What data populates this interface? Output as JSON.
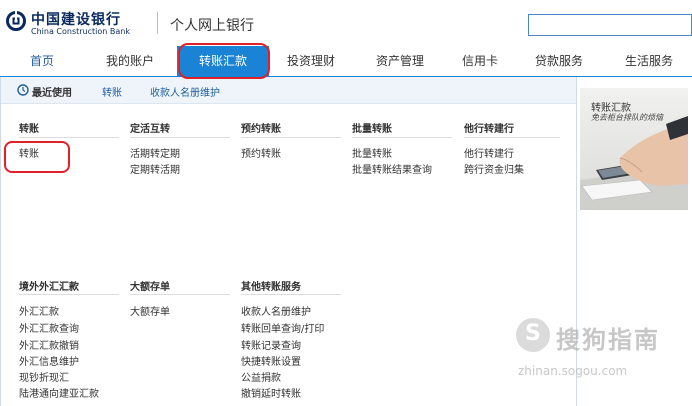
{
  "header": {
    "bank_name_cn": "中国建设银行",
    "bank_name_en": "China Construction Bank",
    "site_title": "个人网上银行"
  },
  "nav": {
    "items": [
      "首页",
      "我的账户",
      "转账汇款",
      "投资理财",
      "资产管理",
      "信用卡",
      "贷款服务",
      "生活服务"
    ],
    "active": "转账汇款"
  },
  "quickbar": {
    "label": "最近使用",
    "links": [
      "转账",
      "收款人名册维护"
    ]
  },
  "sections_row1": [
    {
      "title": "转账",
      "links": [
        "转账"
      ]
    },
    {
      "title": "定活互转",
      "links": [
        "活期转定期",
        "定期转活期"
      ]
    },
    {
      "title": "预约转账",
      "links": [
        "预约转账"
      ]
    },
    {
      "title": "批量转账",
      "links": [
        "批量转账",
        "批量转账结果查询"
      ]
    },
    {
      "title": "他行转建行",
      "links": [
        "他行转建行",
        "跨行资金归集"
      ]
    }
  ],
  "sections_row2": [
    {
      "title": "境外外汇汇款",
      "links": [
        "外汇汇款",
        "外汇汇款查询",
        "外汇汇款撤销",
        "外汇信息维护",
        "现钞折现汇",
        "陆港通向建亚汇款"
      ]
    },
    {
      "title": "大额存单",
      "links": [
        "大额存单"
      ]
    },
    {
      "title": "其他转账服务",
      "links": [
        "收款人名册维护",
        "转账回单查询/打印",
        "转账记录查询",
        "快捷转账设置",
        "公益捐款",
        "撤销延时转账"
      ]
    }
  ],
  "ad": {
    "title": "转账汇款",
    "subtitle": "免去柜台排队的烦恼"
  },
  "watermark": {
    "text": "搜狗指南",
    "url": "zhinan.sogou.com"
  },
  "colors": {
    "accent": "#1a83d6",
    "brand": "#0a2a5e",
    "highlight_oval": "#e0202a"
  }
}
